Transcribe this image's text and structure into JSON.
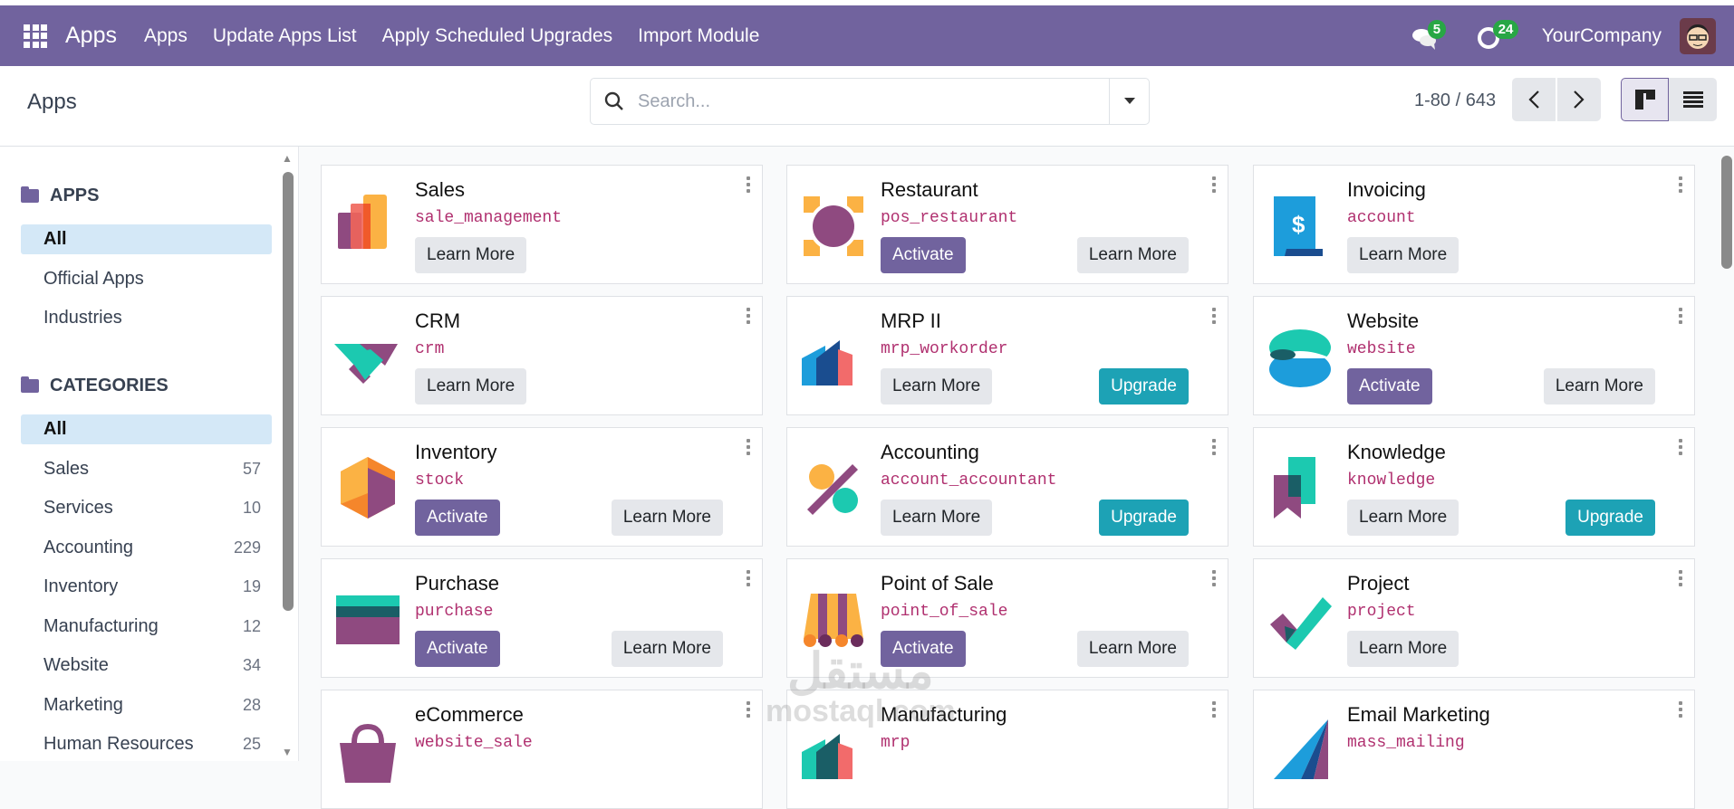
{
  "navbar": {
    "brand": "Apps",
    "items": [
      "Apps",
      "Update Apps List",
      "Apply Scheduled Upgrades",
      "Import Module"
    ],
    "messages_count": "5",
    "activities_count": "24",
    "company": "YourCompany"
  },
  "control": {
    "breadcrumb": "Apps",
    "search_placeholder": "Search...",
    "pager": "1-80 / 643"
  },
  "sidebar": {
    "apps_header": "APPS",
    "apps": [
      {
        "label": "All",
        "active": true
      },
      {
        "label": "Official Apps"
      },
      {
        "label": "Industries"
      }
    ],
    "categories_header": "CATEGORIES",
    "categories": [
      {
        "label": "All",
        "count": "",
        "active": true
      },
      {
        "label": "Sales",
        "count": "57"
      },
      {
        "label": "Services",
        "count": "10"
      },
      {
        "label": "Accounting",
        "count": "229"
      },
      {
        "label": "Inventory",
        "count": "19"
      },
      {
        "label": "Manufacturing",
        "count": "12"
      },
      {
        "label": "Website",
        "count": "34"
      },
      {
        "label": "Marketing",
        "count": "28"
      },
      {
        "label": "Human Resources",
        "count": "25"
      }
    ]
  },
  "cards": [
    {
      "name": "Sales",
      "module": "sale_management",
      "icon": "sales",
      "buttons": [
        {
          "label": "Learn More",
          "kind": "learn",
          "pos": "left"
        }
      ]
    },
    {
      "name": "Restaurant",
      "module": "pos_restaurant",
      "icon": "restaurant",
      "buttons": [
        {
          "label": "Activate",
          "kind": "activate",
          "pos": "left"
        },
        {
          "label": "Learn More",
          "kind": "learn",
          "pos": "right"
        }
      ]
    },
    {
      "name": "Invoicing",
      "module": "account",
      "icon": "invoicing",
      "buttons": [
        {
          "label": "Learn More",
          "kind": "learn",
          "pos": "left"
        }
      ]
    },
    {
      "name": "CRM",
      "module": "crm",
      "icon": "crm",
      "buttons": [
        {
          "label": "Learn More",
          "kind": "learn",
          "pos": "left"
        }
      ]
    },
    {
      "name": "MRP II",
      "module": "mrp_workorder",
      "icon": "mrp2",
      "buttons": [
        {
          "label": "Learn More",
          "kind": "learn",
          "pos": "left"
        },
        {
          "label": "Upgrade",
          "kind": "upgrade",
          "pos": "right"
        }
      ]
    },
    {
      "name": "Website",
      "module": "website",
      "icon": "website",
      "buttons": [
        {
          "label": "Activate",
          "kind": "activate",
          "pos": "left"
        },
        {
          "label": "Learn More",
          "kind": "learn",
          "pos": "right"
        }
      ]
    },
    {
      "name": "Inventory",
      "module": "stock",
      "icon": "inventory",
      "buttons": [
        {
          "label": "Activate",
          "kind": "activate",
          "pos": "left"
        },
        {
          "label": "Learn More",
          "kind": "learn",
          "pos": "right"
        }
      ]
    },
    {
      "name": "Accounting",
      "module": "account_accountant",
      "icon": "accounting",
      "buttons": [
        {
          "label": "Learn More",
          "kind": "learn",
          "pos": "left"
        },
        {
          "label": "Upgrade",
          "kind": "upgrade",
          "pos": "right"
        }
      ]
    },
    {
      "name": "Knowledge",
      "module": "knowledge",
      "icon": "knowledge",
      "buttons": [
        {
          "label": "Learn More",
          "kind": "learn",
          "pos": "left"
        },
        {
          "label": "Upgrade",
          "kind": "upgrade",
          "pos": "right"
        }
      ]
    },
    {
      "name": "Purchase",
      "module": "purchase",
      "icon": "purchase",
      "buttons": [
        {
          "label": "Activate",
          "kind": "activate",
          "pos": "left"
        },
        {
          "label": "Learn More",
          "kind": "learn",
          "pos": "right"
        }
      ]
    },
    {
      "name": "Point of Sale",
      "module": "point_of_sale",
      "icon": "pos",
      "buttons": [
        {
          "label": "Activate",
          "kind": "activate",
          "pos": "left"
        },
        {
          "label": "Learn More",
          "kind": "learn",
          "pos": "right"
        }
      ]
    },
    {
      "name": "Project",
      "module": "project",
      "icon": "project",
      "buttons": [
        {
          "label": "Learn More",
          "kind": "learn",
          "pos": "left"
        }
      ]
    },
    {
      "name": "eCommerce",
      "module": "website_sale",
      "icon": "ecommerce",
      "buttons": []
    },
    {
      "name": "Manufacturing",
      "module": "mrp",
      "icon": "manufacturing",
      "buttons": []
    },
    {
      "name": "Email Marketing",
      "module": "mass_mailing",
      "icon": "email",
      "buttons": []
    }
  ],
  "watermark": {
    "arabic": "مستقل",
    "latin": "mostaql.com"
  },
  "colors": {
    "navbar": "#71639e",
    "activate": "#71639e",
    "upgrade": "#1da2b5",
    "module": "#b0306f"
  }
}
